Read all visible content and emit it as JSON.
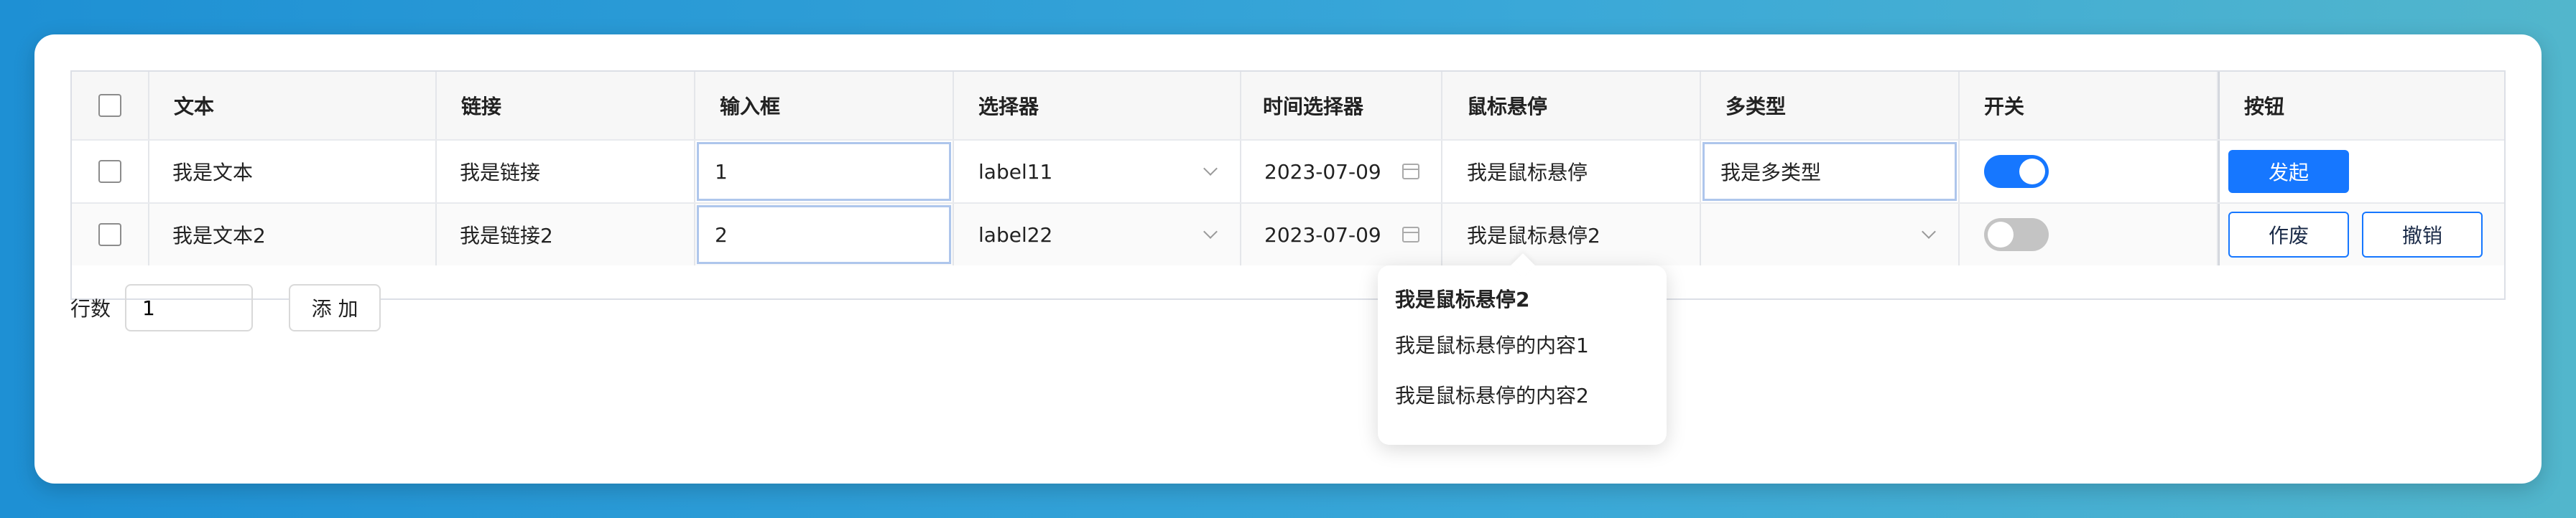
{
  "table": {
    "columns": [
      "文本",
      "链接",
      "输入框",
      "选择器",
      "时间选择器",
      "鼠标悬停",
      "多类型",
      "开关",
      "按钮"
    ],
    "rows": [
      {
        "checked": false,
        "text": "我是文本",
        "link": "我是链接",
        "input": "1",
        "select": "label11",
        "date": "2023-07-09",
        "hover": "我是鼠标悬停",
        "multi": "我是多类型",
        "switch_on": true,
        "buttons": [
          "发起"
        ]
      },
      {
        "checked": false,
        "text": "我是文本2",
        "link": "我是链接2",
        "input": "2",
        "select": "label22",
        "date": "2023-07-09",
        "hover": "我是鼠标悬停2",
        "multi": "",
        "switch_on": false,
        "buttons": [
          "作废",
          "撤销"
        ]
      }
    ]
  },
  "footer": {
    "rows_label": "行数",
    "rows_value": "1",
    "add_label": "添 加"
  },
  "popover": {
    "title": "我是鼠标悬停2",
    "lines": [
      "我是鼠标悬停的内容1",
      "我是鼠标悬停的内容2"
    ]
  },
  "colors": {
    "primary": "#1677ff",
    "background_gradient_start": "#1e90d4",
    "background_gradient_end": "#52b6cc"
  }
}
